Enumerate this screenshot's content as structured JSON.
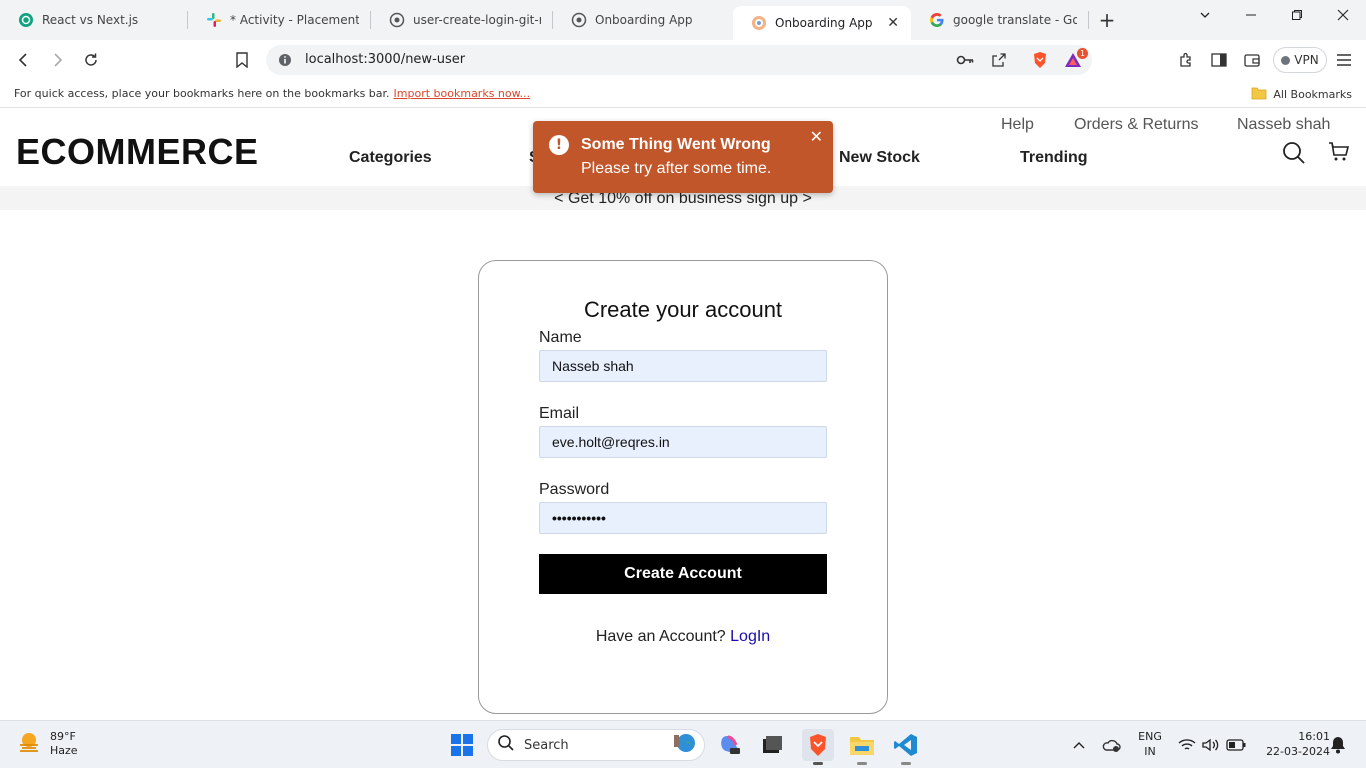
{
  "browser": {
    "tabs": [
      {
        "title": "React vs Next.js",
        "icon": "chatgpt-icon"
      },
      {
        "title": "* Activity - Placements Mi",
        "icon": "slack-icon"
      },
      {
        "title": "user-create-login-git-mai",
        "icon": "globe-icon"
      },
      {
        "title": "Onboarding App",
        "icon": "globe-icon"
      },
      {
        "title": "Onboarding App",
        "icon": "app-icon",
        "active": true
      },
      {
        "title": "google translate - Google",
        "icon": "google-icon"
      }
    ],
    "url": "localhost:3000/new-user",
    "vpn_label": "VPN",
    "notification_count": "1",
    "bookmarks_hint": "For quick access, place your bookmarks here on the bookmarks bar.",
    "import_link": "Import bookmarks now...",
    "all_bookmarks": "All Bookmarks"
  },
  "site": {
    "logo": "ECOMMERCE",
    "util_links": {
      "help": "Help",
      "orders": "Orders & Returns",
      "user": "Nasseb shah"
    },
    "nav": {
      "categories": "Categories",
      "hidden_item_initial": "S",
      "new_stock": "New Stock",
      "trending": "Trending"
    },
    "promo": "< Get 10% off on business sign up >"
  },
  "toast": {
    "title": "Some Thing Went Wrong",
    "message": "Please try after some time.",
    "icon": "exclamation-icon",
    "color": "#c1562b"
  },
  "form": {
    "heading": "Create your account",
    "name_label": "Name",
    "name_value": "Nasseb shah",
    "email_label": "Email",
    "email_value": "eve.holt@reqres.in",
    "password_label": "Password",
    "password_mask": "•••••••••••",
    "submit_label": "Create Account",
    "have_account": "Have an Account?",
    "login_link": "LogIn"
  },
  "taskbar": {
    "weather_temp": "89°F",
    "weather_desc": "Haze",
    "search_placeholder": "Search",
    "lang_top": "ENG",
    "lang_bottom": "IN",
    "time": "16:01",
    "date": "22-03-2024"
  }
}
